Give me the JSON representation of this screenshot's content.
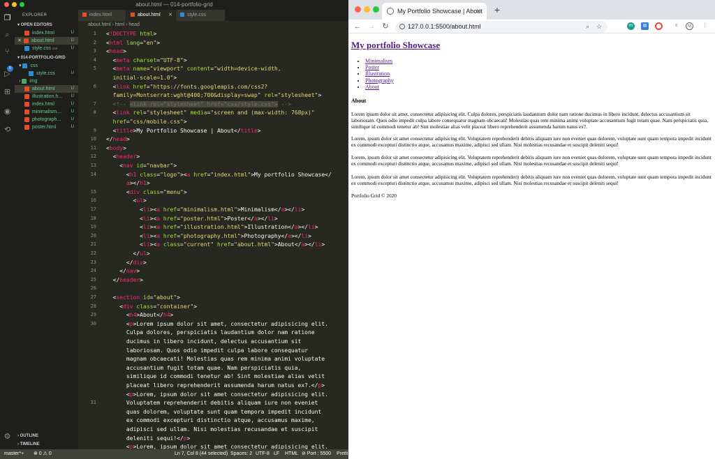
{
  "vscode": {
    "window_title": "about.html — 014-portfolio-grid",
    "explorer_title": "EXPLORER",
    "open_editors_title": "OPEN EDITORS",
    "open_editors": [
      {
        "name": "index.html",
        "status": "U"
      },
      {
        "name": "about.html",
        "status": "U"
      },
      {
        "name": "style.css",
        "folder": "css",
        "status": "U"
      }
    ],
    "project_title": "014-PORTFOLIO-GRID",
    "tree": [
      {
        "name": "css",
        "status": ""
      },
      {
        "name": "style.css",
        "status": "U"
      },
      {
        "name": "img",
        "status": ""
      },
      {
        "name": "about.html",
        "status": "U"
      },
      {
        "name": "illustration.h...",
        "status": "U"
      },
      {
        "name": "index.html",
        "status": "U"
      },
      {
        "name": "minimalism....",
        "status": "U"
      },
      {
        "name": "photograph...",
        "status": "U"
      },
      {
        "name": "poster.html",
        "status": "U"
      }
    ],
    "outline": "OUTLINE",
    "timeline": "TIMELINE",
    "tabs": [
      {
        "label": "index.html"
      },
      {
        "label": "about.html"
      },
      {
        "label": "style.css"
      }
    ],
    "breadcrumb": "about.html › html › head",
    "line_numbers": [
      "1",
      "2",
      "3",
      "4",
      "5",
      "",
      "6",
      "",
      "7",
      "8",
      "",
      "9",
      "10",
      "11",
      "12",
      "13",
      "14",
      "",
      "15",
      "16",
      "17",
      "18",
      "19",
      "20",
      "21",
      "22",
      "23",
      "24",
      "25",
      "26",
      "27",
      "28",
      "29",
      "30",
      "",
      "",
      "",
      "",
      "",
      "",
      "",
      "",
      "31",
      "",
      "",
      "",
      "",
      "",
      "",
      "32"
    ],
    "status": {
      "branch": "master*+",
      "problems": "⊗ 0 ⚠ 0",
      "position": "Ln 7, Col 8 (44 selected)",
      "spaces": "Spaces: 2",
      "encoding": "UTF-8",
      "eol": "LF",
      "language": "HTML",
      "port": "⊘ Port : 5500",
      "prettier": "Pretti"
    }
  },
  "browser": {
    "tab_title": "My Portfolio Showcase | About",
    "url": "127.0.0.1:5500/about.html",
    "page": {
      "heading": "My portfolio Showcase",
      "menu": [
        "Minimalism",
        "Poster",
        "Illustration",
        "Photography",
        "About"
      ],
      "section_heading": "About",
      "paragraphs": [
        "Lorem ipsum dolor sit amet, consectetur adipisicing elit. Culpa dolores, perspiciatis laudantium dolor nam ratione ducimus in libero incidunt, delectus accusantium sit laboriosam. Quos odio impedit culpa labore consequatur magnam obcaecati! Molestias quas rem minima animi voluptate accusantium fugit totam quae. Nam perspiciatis quia, similique id commodi tenetur ab! Sint molestiae alias velit placeat libero reprehenderit assumenda harum natus ex?.",
        "Lorem, ipsum dolor sit amet consectetur adipisicing elit. Voluptatem reprehenderit debitis aliquam iure non eveniet quas dolorem, voluptate sunt quam tempora impedit incidunt ex commodi excepturi distinctio atque, accusamus maxime, adipisci sed ullam. Nisi molestias recusandae et suscipit deleniti sequi!",
        "Lorem, ipsum dolor sit amet consectetur adipisicing elit. Voluptatem reprehenderit debitis aliquam iure non eveniet quas dolorem, voluptate sunt quam tempora impedit incidunt ex commodi excepturi distinctio atque, accusamus maxime, adipisci sed ullam. Nisi molestias recusandae et suscipit deleniti sequi!",
        "Lorem, ipsum dolor sit amet consectetur adipisicing elit. Voluptatem reprehenderit debitis aliquam iure non eveniet quas dolorem, voluptate sunt quam tempora impedit incidunt ex commodi excepturi distinctio atque, accusamus maxime, adipisci sed ullam. Nisi molestias recusandae et suscipit deleniti sequi!"
      ],
      "footer": "Portfolio Grid © 2020"
    }
  },
  "colors": {
    "editor_bg": "#272822",
    "tag": "#f92672",
    "attr": "#a6e22e",
    "string": "#e6db74",
    "link_visited": "#551a8b"
  }
}
